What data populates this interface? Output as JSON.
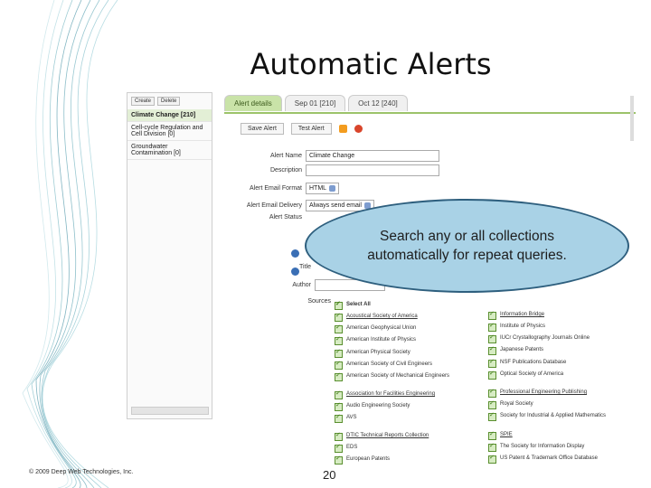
{
  "slide": {
    "title": "Automatic Alerts",
    "footer": "© 2009 Deep Web Technologies, Inc.",
    "page_number": "20",
    "callout": "Search any or all collections automatically for repeat queries."
  },
  "left_panel": {
    "buttons": [
      "Create",
      "Delete"
    ],
    "collections": [
      {
        "name": "Climate Change",
        "count": "[210]"
      },
      {
        "name": "Cell-cycle Regulation and Cell Division",
        "count": "[0]"
      },
      {
        "name": "Groundwater Contamination",
        "count": "[0]"
      }
    ]
  },
  "tabs": [
    "Alert details",
    "Sep 01 [210]",
    "Oct 12 [240]"
  ],
  "toolbar": {
    "save": "Save Alert",
    "test": "Test Alert"
  },
  "form": {
    "alert_name_label": "Alert Name",
    "alert_name_value": "Climate Change",
    "description_label": "Description",
    "email_format_label": "Alert Email Format",
    "email_format_value": "HTML",
    "email_delivery_label": "Alert Email Delivery",
    "email_delivery_value": "Always send email",
    "status_label": "Alert Status",
    "title_label": "Title",
    "author_label": "Author",
    "sources_label": "Sources"
  },
  "sources": {
    "select_all": "Select All",
    "left": [
      "Acoustical Society of America",
      "American Geophysical Union",
      "American Institute of Physics",
      "American Physical Society",
      "American Society of Civil Engineers",
      "American Society of Mechanical Engineers",
      "Association for Facilities Engineering",
      "Audio Engineering Society",
      "AVS",
      "DTIC Technical Reports Collection",
      "EDS",
      "European Patents"
    ],
    "right": [
      "Information Bridge",
      "Institute of Physics",
      "IUCr Crystallography Journals Online",
      "Japanese Patents",
      "NSF Publications Database",
      "Optical Society of America",
      "Professional Engineering Publishing",
      "Royal Society",
      "Society for Industrial & Applied Mathematics",
      "SPIE",
      "The Society for Information Display",
      "US Patent & Trademark Office Database"
    ]
  },
  "colors": {
    "tab_active": "#c9e3a8",
    "callout_fill": "#a9d2e6",
    "callout_border": "#2e5f7e"
  }
}
